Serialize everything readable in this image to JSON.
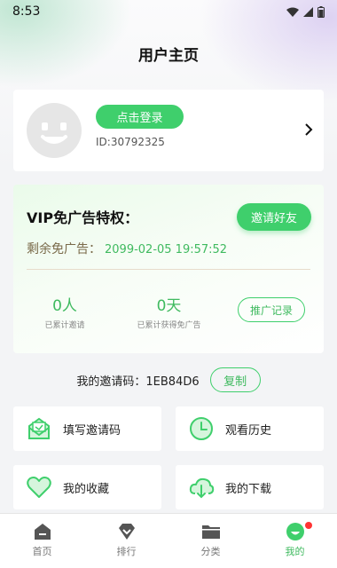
{
  "status_bar": {
    "time": "8:53"
  },
  "page_title": "用户主页",
  "profile": {
    "login_label": "点击登录",
    "user_id": "ID:30792325"
  },
  "vip": {
    "title": "VIP免广告特权：",
    "invite_label": "邀请好友",
    "remain_label": "剩余免广告：",
    "remain_value": "2099-02-05 19:57:52",
    "stats": [
      {
        "value": "0人",
        "label": "已累计邀请"
      },
      {
        "value": "0天",
        "label": "已累计获得免广告"
      }
    ],
    "promo_label": "推广记录"
  },
  "invite_code": {
    "text": "我的邀请码：1EB84D6",
    "copy_label": "复制"
  },
  "tiles": [
    {
      "label": "填写邀请码",
      "icon": "mail-icon"
    },
    {
      "label": "观看历史",
      "icon": "clock-icon"
    },
    {
      "label": "我的收藏",
      "icon": "heart-icon"
    },
    {
      "label": "我的下载",
      "icon": "cloud-download-icon"
    }
  ],
  "nav": [
    {
      "label": "首页",
      "icon": "home-icon"
    },
    {
      "label": "排行",
      "icon": "diamond-icon"
    },
    {
      "label": "分类",
      "icon": "folder-icon"
    },
    {
      "label": "我的",
      "icon": "face-icon"
    }
  ],
  "colors": {
    "accent": "#3fcf6c",
    "accent_text": "#3fba5f",
    "remain_label": "#7a6a4a",
    "badge": "#ff3333"
  }
}
